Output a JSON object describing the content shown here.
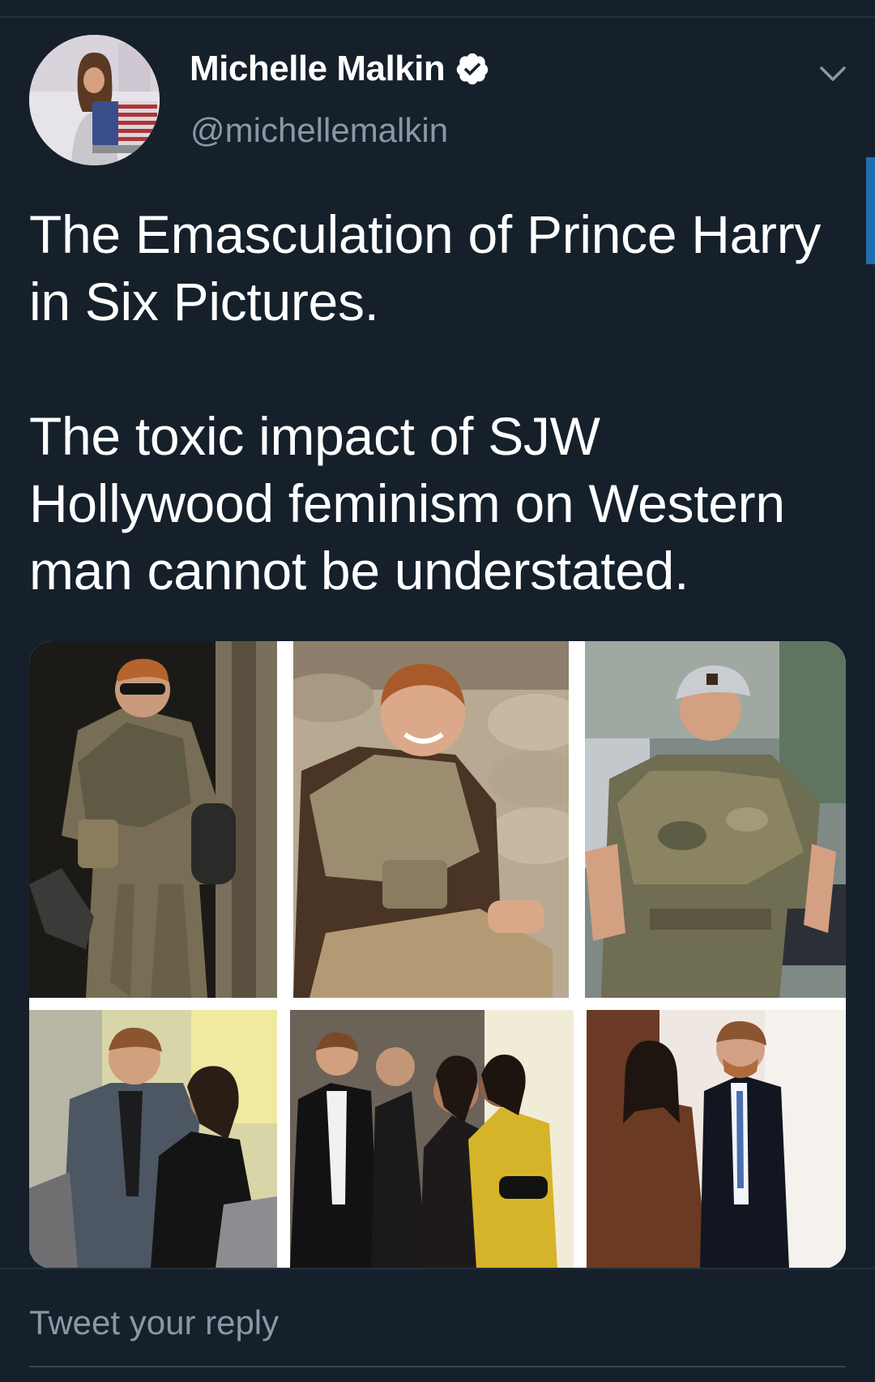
{
  "tweet": {
    "author": {
      "display_name": "Michelle Malkin",
      "handle": "@michellemalkin",
      "verified": true,
      "verified_icon": "verified-badge-icon"
    },
    "text_paragraphs": [
      "The Emasculation of Prince Harry in Six Pictures.",
      "The toxic impact of SJW Hollywood feminism on Western man cannot be understated."
    ],
    "media": {
      "count": 6,
      "photos": [
        {
          "id": "military-1"
        },
        {
          "id": "military-2"
        },
        {
          "id": "military-3"
        },
        {
          "id": "event-1"
        },
        {
          "id": "event-2"
        },
        {
          "id": "event-3"
        }
      ]
    },
    "menu_icon": "chevron-down-icon"
  },
  "reply": {
    "placeholder": "Tweet your reply"
  },
  "colors": {
    "background": "#15202b",
    "primary_text": "#ffffff",
    "secondary_text": "#8899a6",
    "accent": "#1da1f2"
  }
}
